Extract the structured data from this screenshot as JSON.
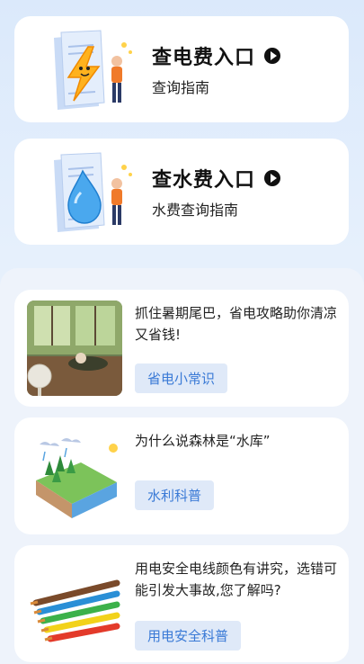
{
  "services": [
    {
      "title": "查电费入口",
      "subtitle": "查询指南",
      "illustration": "electric-bolt-character-icon"
    },
    {
      "title": "查水费入口",
      "subtitle": "水费查询指南",
      "illustration": "water-drop-character-icon"
    }
  ],
  "articles": [
    {
      "title": "抓住暑期尾巴，省电攻略助你清凉又省钱!",
      "tag": "省电小常识"
    },
    {
      "title": "为什么说森林是“水库”",
      "tag": "水利科普"
    },
    {
      "title": "用电安全电线颜色有讲究，选错可能引发大事故,您了解吗?",
      "tag": "用电安全科普"
    }
  ],
  "colors": {
    "accent": "#3a7ad6",
    "tag_bg": "#dfe9f8",
    "background": "#dbe9fb"
  }
}
